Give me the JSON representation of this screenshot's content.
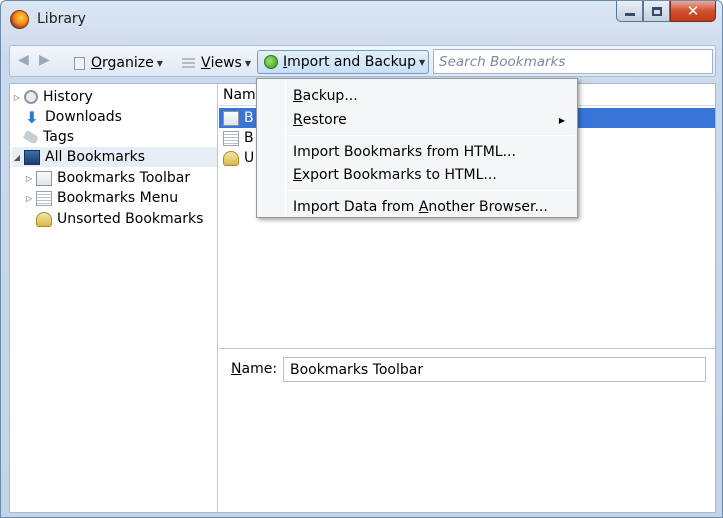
{
  "window": {
    "title": "Library"
  },
  "toolbar": {
    "back_symbol": "◀",
    "forward_symbol": "▶",
    "organize_label": "Organize",
    "organize_mnemonic": "O",
    "organize_rest": "rganize",
    "views_mnemonic": "V",
    "views_rest": "iews",
    "import_mnemonic": "I",
    "import_rest": "mport and Backup",
    "search_placeholder": "Search Bookmarks"
  },
  "sidebar": {
    "items": [
      {
        "label": "History",
        "icon": "history-icon"
      },
      {
        "label": "Downloads",
        "icon": "downloads-icon"
      },
      {
        "label": "Tags",
        "icon": "tags-icon"
      },
      {
        "label": "All Bookmarks",
        "icon": "all-bookmarks-icon"
      },
      {
        "label": "Bookmarks Toolbar",
        "icon": "bookmarks-toolbar-icon"
      },
      {
        "label": "Bookmarks Menu",
        "icon": "bookmarks-menu-icon"
      },
      {
        "label": "Unsorted Bookmarks",
        "icon": "unsorted-bookmarks-icon"
      }
    ]
  },
  "list": {
    "column_header": "Nam",
    "rows": [
      {
        "label": "B"
      },
      {
        "label": "B"
      },
      {
        "label": "U"
      }
    ]
  },
  "details": {
    "name_mnemonic": "N",
    "name_rest": "ame:",
    "name_value": "Bookmarks Toolbar"
  },
  "menu": {
    "backup": {
      "mnemonic": "B",
      "rest": "ackup..."
    },
    "restore": {
      "mnemonic": "R",
      "rest": "estore"
    },
    "import_html": {
      "label": "Import Bookmarks from HTML..."
    },
    "export_html": {
      "mnemonic": "E",
      "rest": "xport Bookmarks to HTML..."
    },
    "import_browser": {
      "pre": "Import Data from ",
      "mnemonic": "A",
      "rest": "nother Browser..."
    }
  },
  "colors": {
    "selection": "#3875d7",
    "close_button": "#c13a18"
  }
}
